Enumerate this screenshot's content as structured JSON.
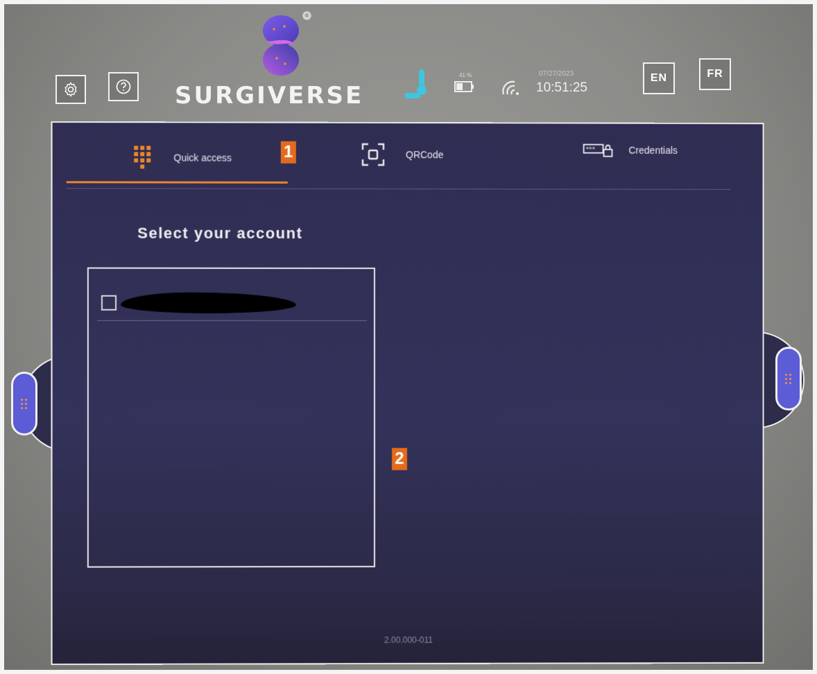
{
  "header": {
    "brand": "SURGIVERSE",
    "battery_percent": "41 %",
    "date": "07/27/2023",
    "time": "10:51:25",
    "languages": [
      "EN",
      "FR"
    ]
  },
  "tabs": [
    {
      "label": "Quick access",
      "icon": "keypad-icon",
      "active": true
    },
    {
      "label": "QRCode",
      "icon": "qr-scan-icon",
      "active": false
    },
    {
      "label": "Credentials",
      "icon": "password-lock-icon",
      "active": false
    }
  ],
  "main": {
    "title": "Select your account",
    "accounts": [
      {
        "label": "",
        "checked": false
      }
    ]
  },
  "footer": {
    "version": "2.00.000-011"
  },
  "markers": [
    "1",
    "2"
  ],
  "colors": {
    "accent": "#e9852c",
    "panel": "#2f2d52",
    "handle": "#5c5cd6",
    "thermo": "#3fc5de"
  }
}
